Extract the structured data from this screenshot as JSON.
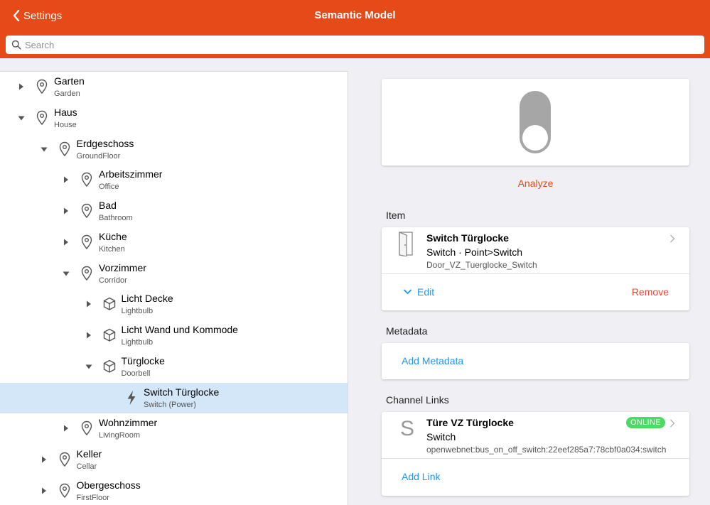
{
  "header": {
    "back_label": "Settings",
    "title": "Semantic Model",
    "accent_color": "#e64a19"
  },
  "search": {
    "placeholder": "Search",
    "value": ""
  },
  "tree": {
    "items": [
      {
        "label": "Garten",
        "sub": "Garden",
        "icon": "location-pin-icon",
        "state": "collapsed",
        "depth": 0
      },
      {
        "label": "Haus",
        "sub": "House",
        "icon": "location-pin-icon",
        "state": "expanded",
        "depth": 0
      },
      {
        "label": "Erdgeschoss",
        "sub": "GroundFloor",
        "icon": "location-pin-icon",
        "state": "expanded",
        "depth": 1
      },
      {
        "label": "Arbeitszimmer",
        "sub": "Office",
        "icon": "location-pin-icon",
        "state": "collapsed",
        "depth": 2
      },
      {
        "label": "Bad",
        "sub": "Bathroom",
        "icon": "location-pin-icon",
        "state": "collapsed",
        "depth": 2
      },
      {
        "label": "Küche",
        "sub": "Kitchen",
        "icon": "location-pin-icon",
        "state": "collapsed",
        "depth": 2
      },
      {
        "label": "Vorzimmer",
        "sub": "Corridor",
        "icon": "location-pin-icon",
        "state": "expanded",
        "depth": 2
      },
      {
        "label": "Licht Decke",
        "sub": "Lightbulb",
        "icon": "equipment-cube-icon",
        "state": "collapsed",
        "depth": 3
      },
      {
        "label": "Licht Wand und Kommode",
        "sub": "Lightbulb",
        "icon": "equipment-cube-icon",
        "state": "collapsed",
        "depth": 3
      },
      {
        "label": "Türglocke",
        "sub": "Doorbell",
        "icon": "equipment-cube-icon",
        "state": "expanded",
        "depth": 3
      },
      {
        "label": "Switch Türglocke",
        "sub": "Switch (Power)",
        "icon": "bolt-icon",
        "state": "leaf",
        "depth": 4,
        "selected": true
      },
      {
        "label": "Wohnzimmer",
        "sub": "LivingRoom",
        "icon": "location-pin-icon",
        "state": "collapsed",
        "depth": 2
      },
      {
        "label": "Keller",
        "sub": "Cellar",
        "icon": "location-pin-icon",
        "state": "collapsed",
        "depth": 1
      },
      {
        "label": "Obergeschoss",
        "sub": "FirstFloor",
        "icon": "location-pin-icon",
        "state": "collapsed",
        "depth": 1
      }
    ]
  },
  "detail": {
    "analyze_label": "Analyze",
    "toggle_state": "off",
    "item_section_title": "Item",
    "item": {
      "name": "Switch Türglocke",
      "type": "Switch · Point>Switch",
      "id": "Door_VZ_Tuerglocke_Switch",
      "icon": "door-icon",
      "edit_label": "Edit",
      "remove_label": "Remove"
    },
    "metadata_section_title": "Metadata",
    "add_metadata_label": "Add Metadata",
    "channel_section_title": "Channel Links",
    "channel": {
      "letter": "S",
      "name": "Türe VZ Türglocke",
      "type": "Switch",
      "uid": "openwebnet:bus_on_off_switch:22eef285a7:78cbf0a034:switch",
      "status": "ONLINE",
      "status_color": "#4cd964"
    },
    "add_link_label": "Add Link"
  }
}
